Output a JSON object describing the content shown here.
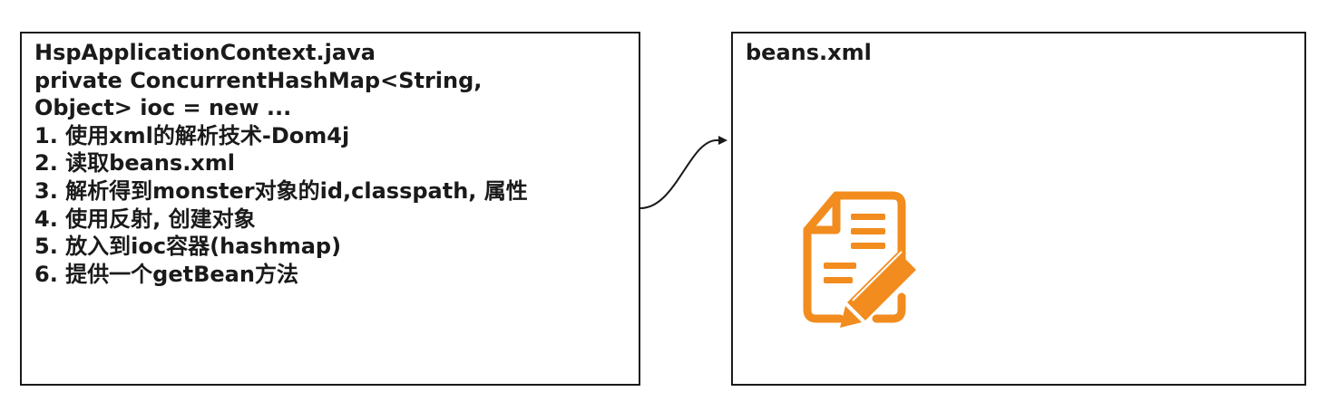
{
  "left_box": {
    "lines": [
      "HspApplicationContext.java",
      "private ConcurrentHashMap<String,",
      "Object> ioc = new ...",
      "1. 使用xml的解析技术-Dom4j",
      "2. 读取beans.xml",
      "3. 解析得到monster对象的id,classpath, 属性",
      "4. 使用反射, 创建对象",
      "5. 放入到ioc容器(hashmap)",
      "6. 提供一个getBean方法"
    ]
  },
  "right_box": {
    "title": "beans.xml",
    "icon": "document-edit-icon"
  },
  "colors": {
    "border": "#1a1a1a",
    "icon": "#f28c1e"
  }
}
